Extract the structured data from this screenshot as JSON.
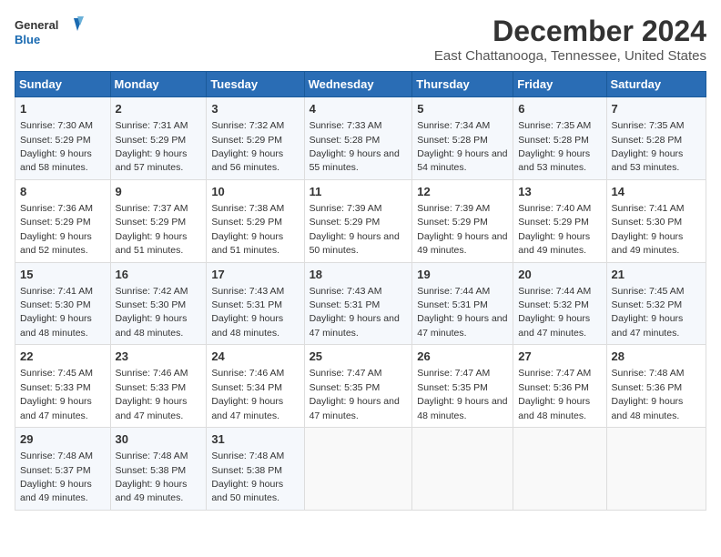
{
  "logo": {
    "line1": "General",
    "line2": "Blue"
  },
  "title": "December 2024",
  "subtitle": "East Chattanooga, Tennessee, United States",
  "colors": {
    "header_bg": "#2a6db5",
    "odd_row": "#f5f8fc",
    "even_row": "#ffffff"
  },
  "weekdays": [
    "Sunday",
    "Monday",
    "Tuesday",
    "Wednesday",
    "Thursday",
    "Friday",
    "Saturday"
  ],
  "weeks": [
    [
      {
        "day": "1",
        "sunrise": "7:30 AM",
        "sunset": "5:29 PM",
        "daylight": "9 hours and 58 minutes."
      },
      {
        "day": "2",
        "sunrise": "7:31 AM",
        "sunset": "5:29 PM",
        "daylight": "9 hours and 57 minutes."
      },
      {
        "day": "3",
        "sunrise": "7:32 AM",
        "sunset": "5:29 PM",
        "daylight": "9 hours and 56 minutes."
      },
      {
        "day": "4",
        "sunrise": "7:33 AM",
        "sunset": "5:28 PM",
        "daylight": "9 hours and 55 minutes."
      },
      {
        "day": "5",
        "sunrise": "7:34 AM",
        "sunset": "5:28 PM",
        "daylight": "9 hours and 54 minutes."
      },
      {
        "day": "6",
        "sunrise": "7:35 AM",
        "sunset": "5:28 PM",
        "daylight": "9 hours and 53 minutes."
      },
      {
        "day": "7",
        "sunrise": "7:35 AM",
        "sunset": "5:28 PM",
        "daylight": "9 hours and 53 minutes."
      }
    ],
    [
      {
        "day": "8",
        "sunrise": "7:36 AM",
        "sunset": "5:29 PM",
        "daylight": "9 hours and 52 minutes."
      },
      {
        "day": "9",
        "sunrise": "7:37 AM",
        "sunset": "5:29 PM",
        "daylight": "9 hours and 51 minutes."
      },
      {
        "day": "10",
        "sunrise": "7:38 AM",
        "sunset": "5:29 PM",
        "daylight": "9 hours and 51 minutes."
      },
      {
        "day": "11",
        "sunrise": "7:39 AM",
        "sunset": "5:29 PM",
        "daylight": "9 hours and 50 minutes."
      },
      {
        "day": "12",
        "sunrise": "7:39 AM",
        "sunset": "5:29 PM",
        "daylight": "9 hours and 49 minutes."
      },
      {
        "day": "13",
        "sunrise": "7:40 AM",
        "sunset": "5:29 PM",
        "daylight": "9 hours and 49 minutes."
      },
      {
        "day": "14",
        "sunrise": "7:41 AM",
        "sunset": "5:30 PM",
        "daylight": "9 hours and 49 minutes."
      }
    ],
    [
      {
        "day": "15",
        "sunrise": "7:41 AM",
        "sunset": "5:30 PM",
        "daylight": "9 hours and 48 minutes."
      },
      {
        "day": "16",
        "sunrise": "7:42 AM",
        "sunset": "5:30 PM",
        "daylight": "9 hours and 48 minutes."
      },
      {
        "day": "17",
        "sunrise": "7:43 AM",
        "sunset": "5:31 PM",
        "daylight": "9 hours and 48 minutes."
      },
      {
        "day": "18",
        "sunrise": "7:43 AM",
        "sunset": "5:31 PM",
        "daylight": "9 hours and 47 minutes."
      },
      {
        "day": "19",
        "sunrise": "7:44 AM",
        "sunset": "5:31 PM",
        "daylight": "9 hours and 47 minutes."
      },
      {
        "day": "20",
        "sunrise": "7:44 AM",
        "sunset": "5:32 PM",
        "daylight": "9 hours and 47 minutes."
      },
      {
        "day": "21",
        "sunrise": "7:45 AM",
        "sunset": "5:32 PM",
        "daylight": "9 hours and 47 minutes."
      }
    ],
    [
      {
        "day": "22",
        "sunrise": "7:45 AM",
        "sunset": "5:33 PM",
        "daylight": "9 hours and 47 minutes."
      },
      {
        "day": "23",
        "sunrise": "7:46 AM",
        "sunset": "5:33 PM",
        "daylight": "9 hours and 47 minutes."
      },
      {
        "day": "24",
        "sunrise": "7:46 AM",
        "sunset": "5:34 PM",
        "daylight": "9 hours and 47 minutes."
      },
      {
        "day": "25",
        "sunrise": "7:47 AM",
        "sunset": "5:35 PM",
        "daylight": "9 hours and 47 minutes."
      },
      {
        "day": "26",
        "sunrise": "7:47 AM",
        "sunset": "5:35 PM",
        "daylight": "9 hours and 48 minutes."
      },
      {
        "day": "27",
        "sunrise": "7:47 AM",
        "sunset": "5:36 PM",
        "daylight": "9 hours and 48 minutes."
      },
      {
        "day": "28",
        "sunrise": "7:48 AM",
        "sunset": "5:36 PM",
        "daylight": "9 hours and 48 minutes."
      }
    ],
    [
      {
        "day": "29",
        "sunrise": "7:48 AM",
        "sunset": "5:37 PM",
        "daylight": "9 hours and 49 minutes."
      },
      {
        "day": "30",
        "sunrise": "7:48 AM",
        "sunset": "5:38 PM",
        "daylight": "9 hours and 49 minutes."
      },
      {
        "day": "31",
        "sunrise": "7:48 AM",
        "sunset": "5:38 PM",
        "daylight": "9 hours and 50 minutes."
      },
      null,
      null,
      null,
      null
    ]
  ],
  "labels": {
    "sunrise": "Sunrise:",
    "sunset": "Sunset:",
    "daylight": "Daylight:"
  }
}
